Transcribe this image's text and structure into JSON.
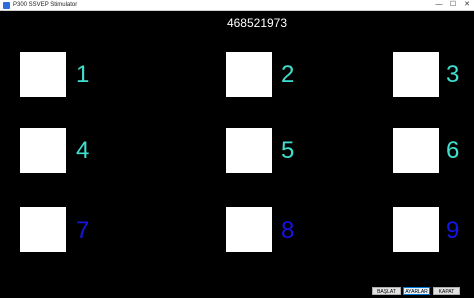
{
  "window": {
    "title": "P300 SSVEP Stimulator",
    "minimize_glyph": "—",
    "maximize_glyph": "☐",
    "close_glyph": "✕"
  },
  "counter": "468521973",
  "stimuli": [
    {
      "label": "1",
      "color": "#40e0d0"
    },
    {
      "label": "2",
      "color": "#40e0d0"
    },
    {
      "label": "3",
      "color": "#40e0d0"
    },
    {
      "label": "4",
      "color": "#40e0d0"
    },
    {
      "label": "5",
      "color": "#40e0d0"
    },
    {
      "label": "6",
      "color": "#40e0d0"
    },
    {
      "label": "7",
      "color": "#1414e6"
    },
    {
      "label": "8",
      "color": "#1414e6"
    },
    {
      "label": "9",
      "color": "#1414e6"
    }
  ],
  "buttons": {
    "start": "BAŞLAT",
    "settings": "AYARLAR",
    "close": "KAPAT"
  },
  "icons": {
    "app": "app-icon"
  }
}
